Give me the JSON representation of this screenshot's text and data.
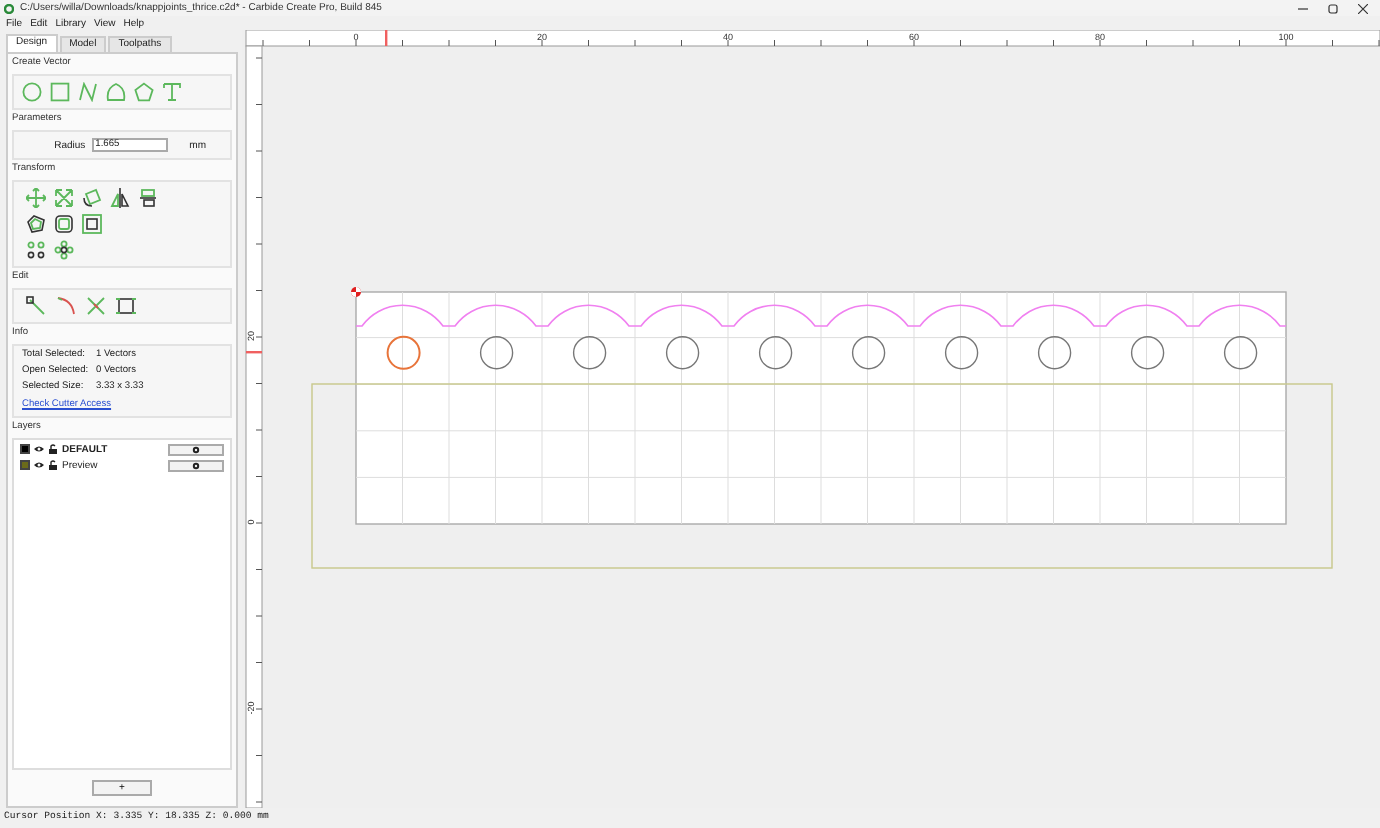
{
  "window": {
    "title": "C:/Users/willa/Downloads/knappjoints_thrice.c2d* - Carbide Create Pro, Build 845"
  },
  "menu": [
    "File",
    "Edit",
    "Library",
    "View",
    "Help"
  ],
  "tabs": [
    {
      "label": "Design",
      "selected": true
    },
    {
      "label": "Model",
      "selected": false
    },
    {
      "label": "Toolpaths",
      "selected": false
    }
  ],
  "sections": {
    "create_vector": "Create Vector",
    "parameters": "Parameters",
    "transform": "Transform",
    "edit": "Edit",
    "info": "Info",
    "layers": "Layers"
  },
  "parameters": {
    "label": "Radius",
    "value": "1.665",
    "unit": "mm"
  },
  "info": [
    {
      "label": "Total Selected:",
      "value": "1 Vectors"
    },
    {
      "label": "Open Selected:",
      "value": "0 Vectors"
    },
    {
      "label": "Selected Size:",
      "value": "3.33 x 3.33"
    }
  ],
  "info_link": "Check Cutter Access",
  "layers": [
    {
      "name": "DEFAULT",
      "color": "#000000",
      "active": true
    },
    {
      "name": "Preview",
      "color": "#6b6b1a",
      "active": false
    }
  ],
  "add_layer_button": "+",
  "rulers": {
    "top_labels": [
      "0",
      "20",
      "40",
      "60",
      "80",
      "100"
    ],
    "left_labels": [
      "20",
      "0",
      "-20"
    ]
  },
  "circles": [
    {
      "selected": true
    },
    {
      "selected": false
    },
    {
      "selected": false
    },
    {
      "selected": false
    },
    {
      "selected": false
    },
    {
      "selected": false
    },
    {
      "selected": false
    },
    {
      "selected": false
    },
    {
      "selected": false
    },
    {
      "selected": false
    }
  ],
  "status_bar": "Cursor Position X: 3.335 Y: 18.335 Z: 0.000 mm"
}
